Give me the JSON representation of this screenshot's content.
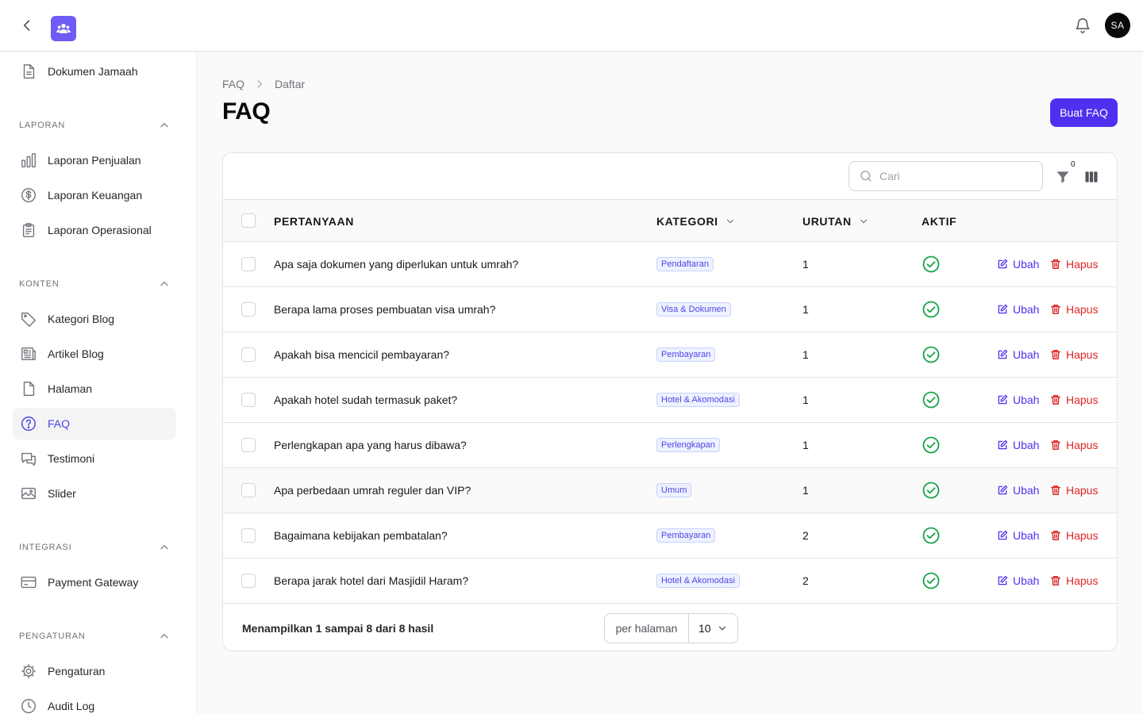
{
  "header": {
    "avatar_initials": "SA",
    "icons": [
      "chevron-left-icon",
      "app-logo-icon",
      "bell-icon"
    ],
    "brand_color": "#6d5df5"
  },
  "sidebar": {
    "top_item": {
      "label": "Dokumen Jamaah",
      "icon": "document-icon"
    },
    "groups": [
      {
        "label": "LAPORAN",
        "items": [
          {
            "label": "Laporan Penjualan",
            "icon": "bar-chart-icon"
          },
          {
            "label": "Laporan Keuangan",
            "icon": "dollar-circle-icon"
          },
          {
            "label": "Laporan Operasional",
            "icon": "clipboard-icon"
          }
        ]
      },
      {
        "label": "KONTEN",
        "items": [
          {
            "label": "Kategori Blog",
            "icon": "tag-icon"
          },
          {
            "label": "Artikel Blog",
            "icon": "newspaper-icon"
          },
          {
            "label": "Halaman",
            "icon": "page-icon"
          },
          {
            "label": "FAQ",
            "icon": "question-circle-icon",
            "active": true
          },
          {
            "label": "Testimoni",
            "icon": "chat-bubbles-icon"
          },
          {
            "label": "Slider",
            "icon": "image-icon"
          }
        ]
      },
      {
        "label": "INTEGRASI",
        "items": [
          {
            "label": "Payment Gateway",
            "icon": "credit-card-icon"
          }
        ]
      },
      {
        "label": "PENGATURAN",
        "items": [
          {
            "label": "Pengaturan",
            "icon": "gear-icon"
          },
          {
            "label": "Audit Log",
            "icon": "clock-icon"
          }
        ]
      }
    ]
  },
  "breadcrumb": {
    "items": [
      "FAQ",
      "Daftar"
    ]
  },
  "page": {
    "title": "FAQ",
    "create_label": "Buat FAQ",
    "accent": "#4f2ff0"
  },
  "toolbar": {
    "search_placeholder": "Cari",
    "search_value": "",
    "filter_count": "0"
  },
  "table": {
    "columns": {
      "question": "PERTANYAAN",
      "category": "KATEGORI",
      "order": "URUTAN",
      "active": "AKTIF"
    },
    "edit_label": "Ubah",
    "delete_label": "Hapus",
    "rows": [
      {
        "question": "Apa saja dokumen yang diperlukan untuk umrah?",
        "category": "Pendaftaran",
        "order": "1",
        "active": true
      },
      {
        "question": "Berapa lama proses pembuatan visa umrah?",
        "category": "Visa & Dokumen",
        "order": "1",
        "active": true
      },
      {
        "question": "Apakah bisa mencicil pembayaran?",
        "category": "Pembayaran",
        "order": "1",
        "active": true
      },
      {
        "question": "Apakah hotel sudah termasuk paket?",
        "category": "Hotel & Akomodasi",
        "order": "1",
        "active": true
      },
      {
        "question": "Perlengkapan apa yang harus dibawa?",
        "category": "Perlengkapan",
        "order": "1",
        "active": true
      },
      {
        "question": "Apa perbedaan umrah reguler dan VIP?",
        "category": "Umum",
        "order": "1",
        "active": true
      },
      {
        "question": "Bagaimana kebijakan pembatalan?",
        "category": "Pembayaran",
        "order": "2",
        "active": true
      },
      {
        "question": "Berapa jarak hotel dari Masjidil Haram?",
        "category": "Hotel & Akomodasi",
        "order": "2",
        "active": true
      }
    ]
  },
  "pagination": {
    "summary": "Menampilkan 1 sampai 8 dari 8 hasil",
    "per_page_label": "per halaman",
    "per_page_value": "10"
  },
  "colors": {
    "success": "#16a34a",
    "danger": "#dc2626",
    "badge_text": "#4f46e5"
  }
}
